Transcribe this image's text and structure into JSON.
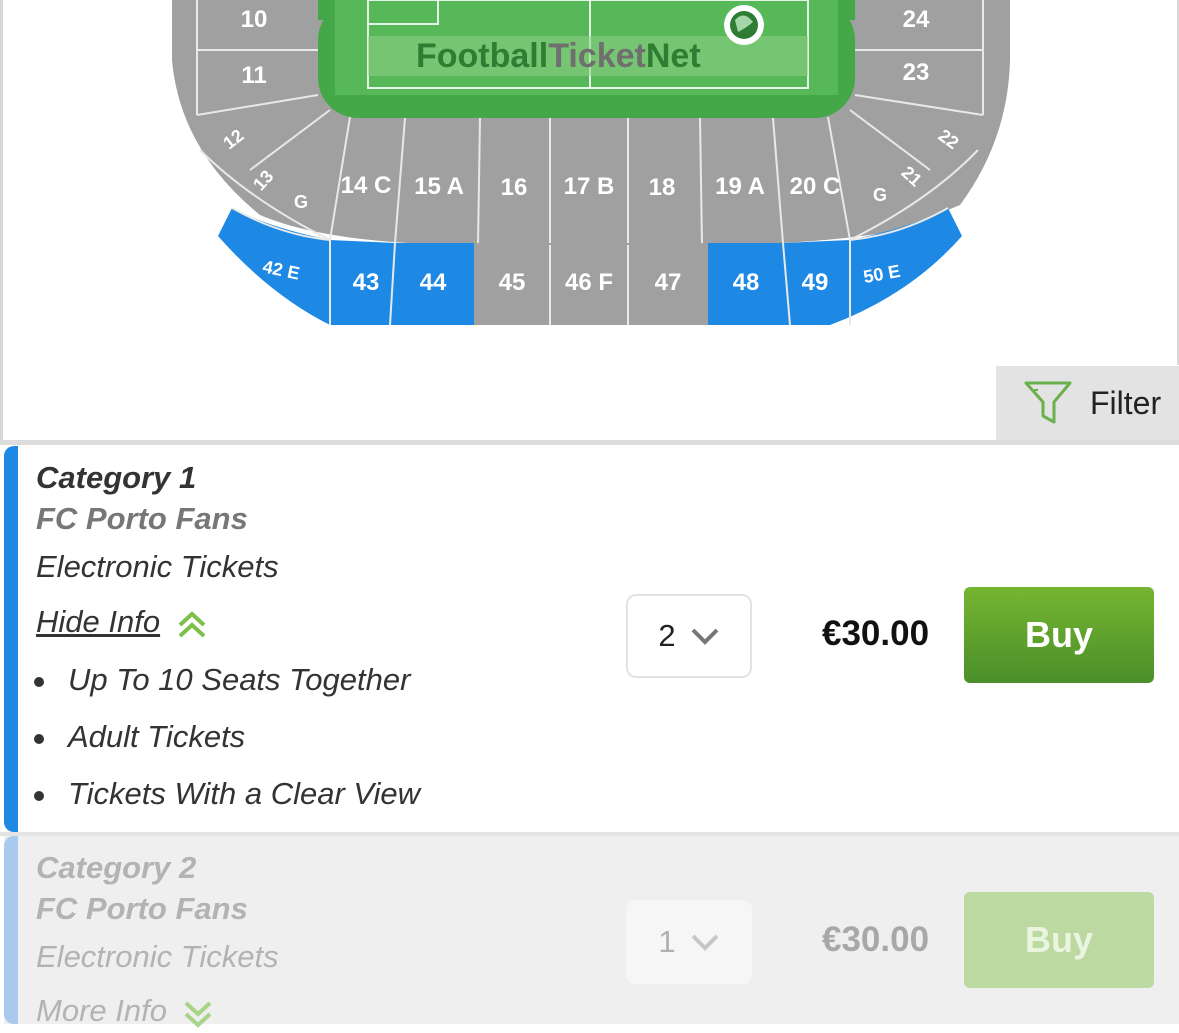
{
  "map": {
    "brand": "FootballTicketNet",
    "brand_part1": "Football",
    "brand_part2": "Ticket",
    "brand_part3": "Net",
    "colors": {
      "seat_gray": "#9e9e9e",
      "seat_available": "#1e88e5",
      "pitch": "#43a047",
      "brand_green": "#2e7d32"
    },
    "sections": {
      "s10": "10",
      "s11": "11",
      "s24": "24",
      "s23": "23",
      "s12": "12",
      "s13": "13",
      "g_left": "G",
      "s14c": "14 C",
      "s15a": "15 A",
      "s16": "16",
      "s17b": "17 B",
      "s18": "18",
      "s19a": "19 A",
      "s20c": "20 C",
      "g_right": "G",
      "s21": "21",
      "s22": "22",
      "s42e": "42 E",
      "s43": "43",
      "s44": "44",
      "s45": "45",
      "s46f": "46 F",
      "s47": "47",
      "s48": "48",
      "s49": "49",
      "s50e": "50 E"
    }
  },
  "filter": {
    "label": "Filter",
    "icon": "funnel-icon"
  },
  "listings": [
    {
      "category": "Category 1",
      "fans": "FC Porto Fans",
      "ticket_type": "Electronic Tickets",
      "info_toggle": "Hide Info",
      "features": [
        "Up To 10 Seats Together",
        "Adult Tickets",
        "Tickets With a Clear View"
      ],
      "quantity": "2",
      "price": "€30.00",
      "buy_label": "Buy"
    },
    {
      "category": "Category 2",
      "fans": "FC Porto Fans",
      "ticket_type": "Electronic Tickets",
      "info_toggle": "More Info",
      "quantity": "1",
      "price": "€30.00",
      "buy_label": "Buy"
    }
  ]
}
